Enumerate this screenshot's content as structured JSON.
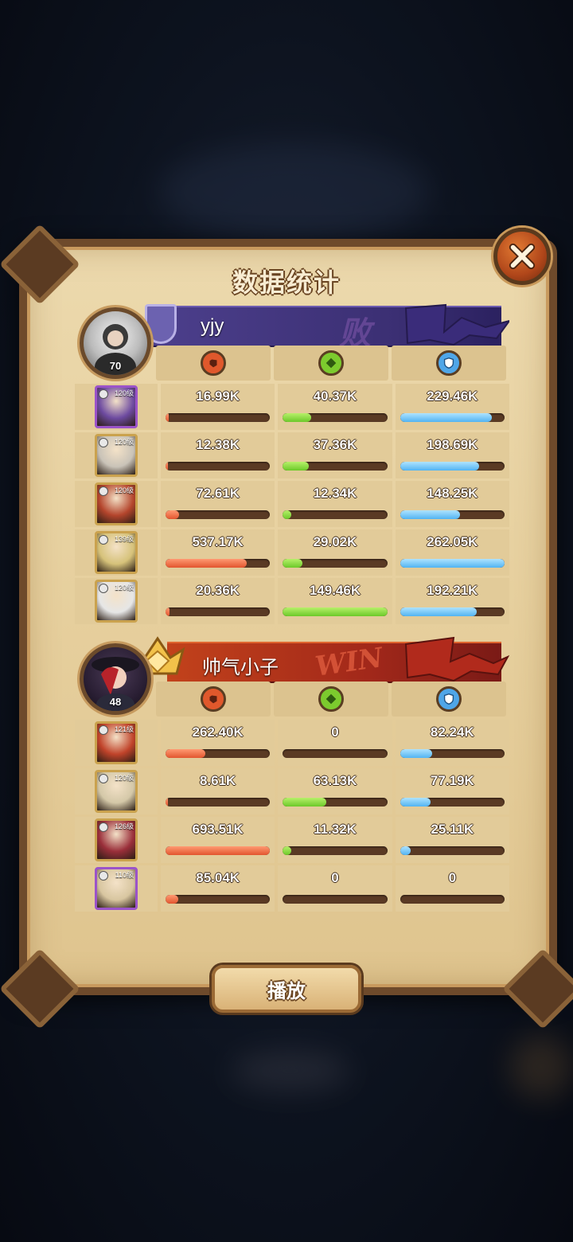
{
  "title": "数据统计",
  "close_icon": "close-x-icon",
  "play_label": "播放",
  "stat_icons": [
    "damage-fist-icon",
    "heal-icon",
    "shield-icon"
  ],
  "teams": [
    {
      "name": "yjy",
      "level": "70",
      "result_stamp": "败",
      "result_color": "#3b2f73",
      "heroes": [
        {
          "level": "120级",
          "frame": "purple",
          "damage": "16.99K",
          "heal": "40.37K",
          "tank": "229.46K",
          "damage_pct": 3,
          "heal_pct": 27,
          "tank_pct": 88
        },
        {
          "level": "120级",
          "frame": "gold",
          "damage": "12.38K",
          "heal": "37.36K",
          "tank": "198.69K",
          "damage_pct": 2,
          "heal_pct": 25,
          "tank_pct": 76
        },
        {
          "level": "120级",
          "frame": "gold",
          "damage": "72.61K",
          "heal": "12.34K",
          "tank": "148.25K",
          "damage_pct": 13,
          "heal_pct": 8,
          "tank_pct": 57
        },
        {
          "level": "139级",
          "frame": "gold",
          "damage": "537.17K",
          "heal": "29.02K",
          "tank": "262.05K",
          "damage_pct": 78,
          "heal_pct": 19,
          "tank_pct": 100
        },
        {
          "level": "120级",
          "frame": "gold",
          "damage": "20.36K",
          "heal": "149.46K",
          "tank": "192.21K",
          "damage_pct": 4,
          "heal_pct": 100,
          "tank_pct": 73
        }
      ]
    },
    {
      "name": "帅气小子",
      "level": "48",
      "result_stamp": "WIN",
      "result_color": "#a2281a",
      "heroes": [
        {
          "level": "121级",
          "frame": "gold",
          "damage": "262.40K",
          "heal": "0",
          "tank": "82.24K",
          "damage_pct": 38,
          "heal_pct": 0,
          "tank_pct": 31
        },
        {
          "level": "120级",
          "frame": "gold",
          "damage": "8.61K",
          "heal": "63.13K",
          "tank": "77.19K",
          "damage_pct": 2,
          "heal_pct": 42,
          "tank_pct": 29
        },
        {
          "level": "126级",
          "frame": "gold",
          "damage": "693.51K",
          "heal": "11.32K",
          "tank": "25.11K",
          "damage_pct": 100,
          "heal_pct": 8,
          "tank_pct": 10
        },
        {
          "level": "110级",
          "frame": "purple",
          "damage": "85.04K",
          "heal": "0",
          "tank": "0",
          "damage_pct": 12,
          "heal_pct": 0,
          "tank_pct": 0
        }
      ]
    }
  ]
}
